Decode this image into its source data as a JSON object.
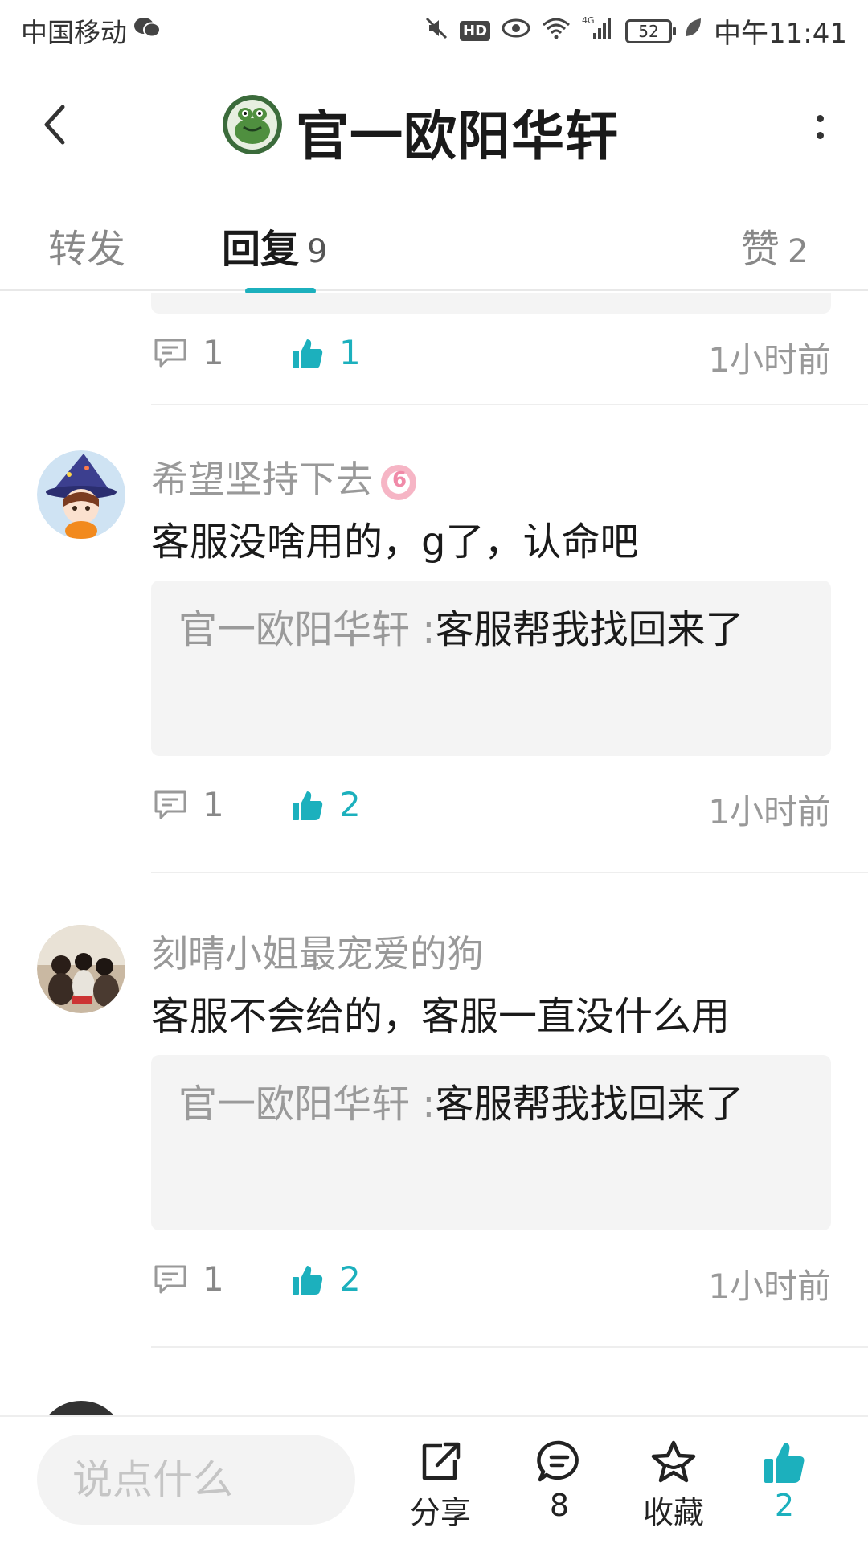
{
  "status_bar": {
    "carrier": "中国移动",
    "network": "4G",
    "hd": "HD",
    "battery": "52",
    "time": "中午11:41"
  },
  "header": {
    "title": "官一欧阳华轩"
  },
  "tabs": [
    {
      "label": "转发",
      "count": ""
    },
    {
      "label": "回复",
      "count": "9"
    },
    {
      "label": "赞",
      "count": "2"
    }
  ],
  "top_actions": {
    "reply_count": "1",
    "like_count": "1",
    "time": "1小时前"
  },
  "comments": [
    {
      "name": "希望坚持下去",
      "text": "客服没啥用的，g了，认命吧",
      "quote_author": "官一欧阳华轩 :",
      "quote_text": "客服帮我找回来了",
      "reply_count": "1",
      "like_count": "2",
      "time": "1小时前"
    },
    {
      "name": "刻晴小姐最宠爱的狗",
      "text": "客服不会给的，客服一直没什么用",
      "quote_author": "官一欧阳华轩 :",
      "quote_text": "客服帮我找回来了",
      "reply_count": "1",
      "like_count": "2",
      "time": "1小时前"
    }
  ],
  "bottom_bar": {
    "input_placeholder": "说点什么",
    "share_label": "分享",
    "comment_count": "8",
    "favorite_label": "收藏",
    "like_count": "2"
  },
  "colors": {
    "accent": "#1cb0bd",
    "quote_bg": "#f4f4f4",
    "muted_text": "#999999"
  }
}
